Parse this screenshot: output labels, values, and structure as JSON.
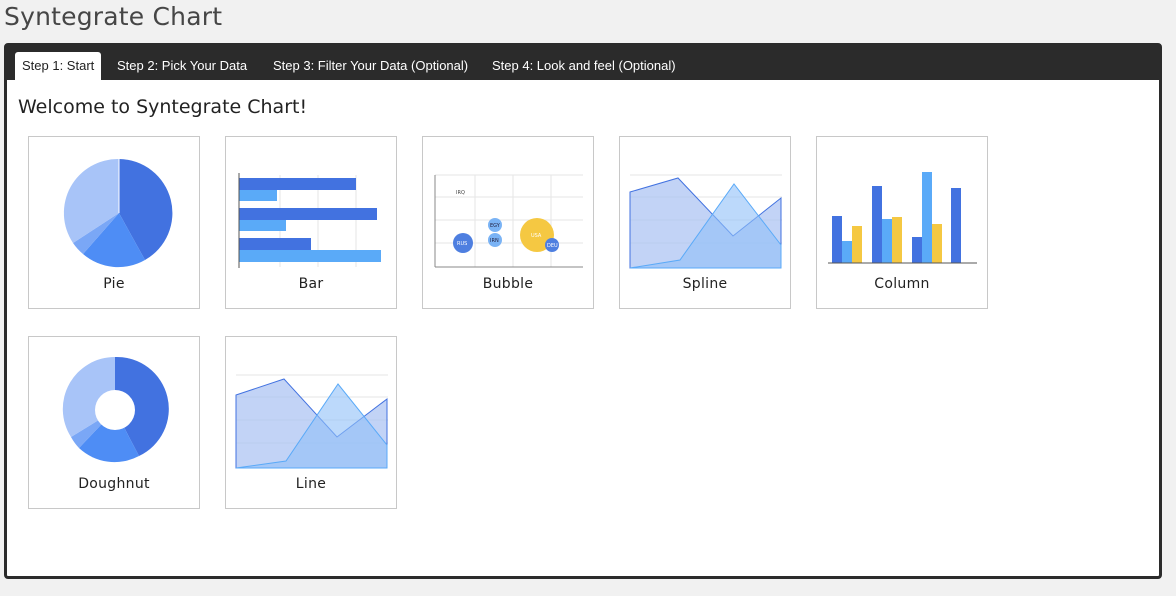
{
  "page": {
    "title": "Syntegrate Chart"
  },
  "tabs": [
    {
      "label": "Step 1: Start",
      "active": true
    },
    {
      "label": "Step 2: Pick Your Data",
      "active": false
    },
    {
      "label": "Step 3: Filter Your Data (Optional)",
      "active": false
    },
    {
      "label": "Step 4: Look and feel (Optional)",
      "active": false
    }
  ],
  "main": {
    "heading": "Welcome to Syntegrate Chart!"
  },
  "chart_types": [
    {
      "label": "Pie",
      "icon": "pie-chart-icon"
    },
    {
      "label": "Bar",
      "icon": "bar-chart-icon"
    },
    {
      "label": "Bubble",
      "icon": "bubble-chart-icon"
    },
    {
      "label": "Spline",
      "icon": "spline-chart-icon"
    },
    {
      "label": "Column",
      "icon": "column-chart-icon"
    },
    {
      "label": "Doughnut",
      "icon": "doughnut-chart-icon"
    },
    {
      "label": "Line",
      "icon": "line-chart-icon"
    }
  ],
  "bubble_labels": [
    "IRQ",
    "EGY",
    "IRN",
    "RUS",
    "USA",
    "DEU"
  ],
  "colors": {
    "blue_dark": "#4272e0",
    "blue_mid": "#4e8df5",
    "blue_light": "#5aaaf8",
    "blue_pale": "#a8c4f8",
    "yellow": "#f5c842",
    "panel_border": "#2b2b2b"
  }
}
